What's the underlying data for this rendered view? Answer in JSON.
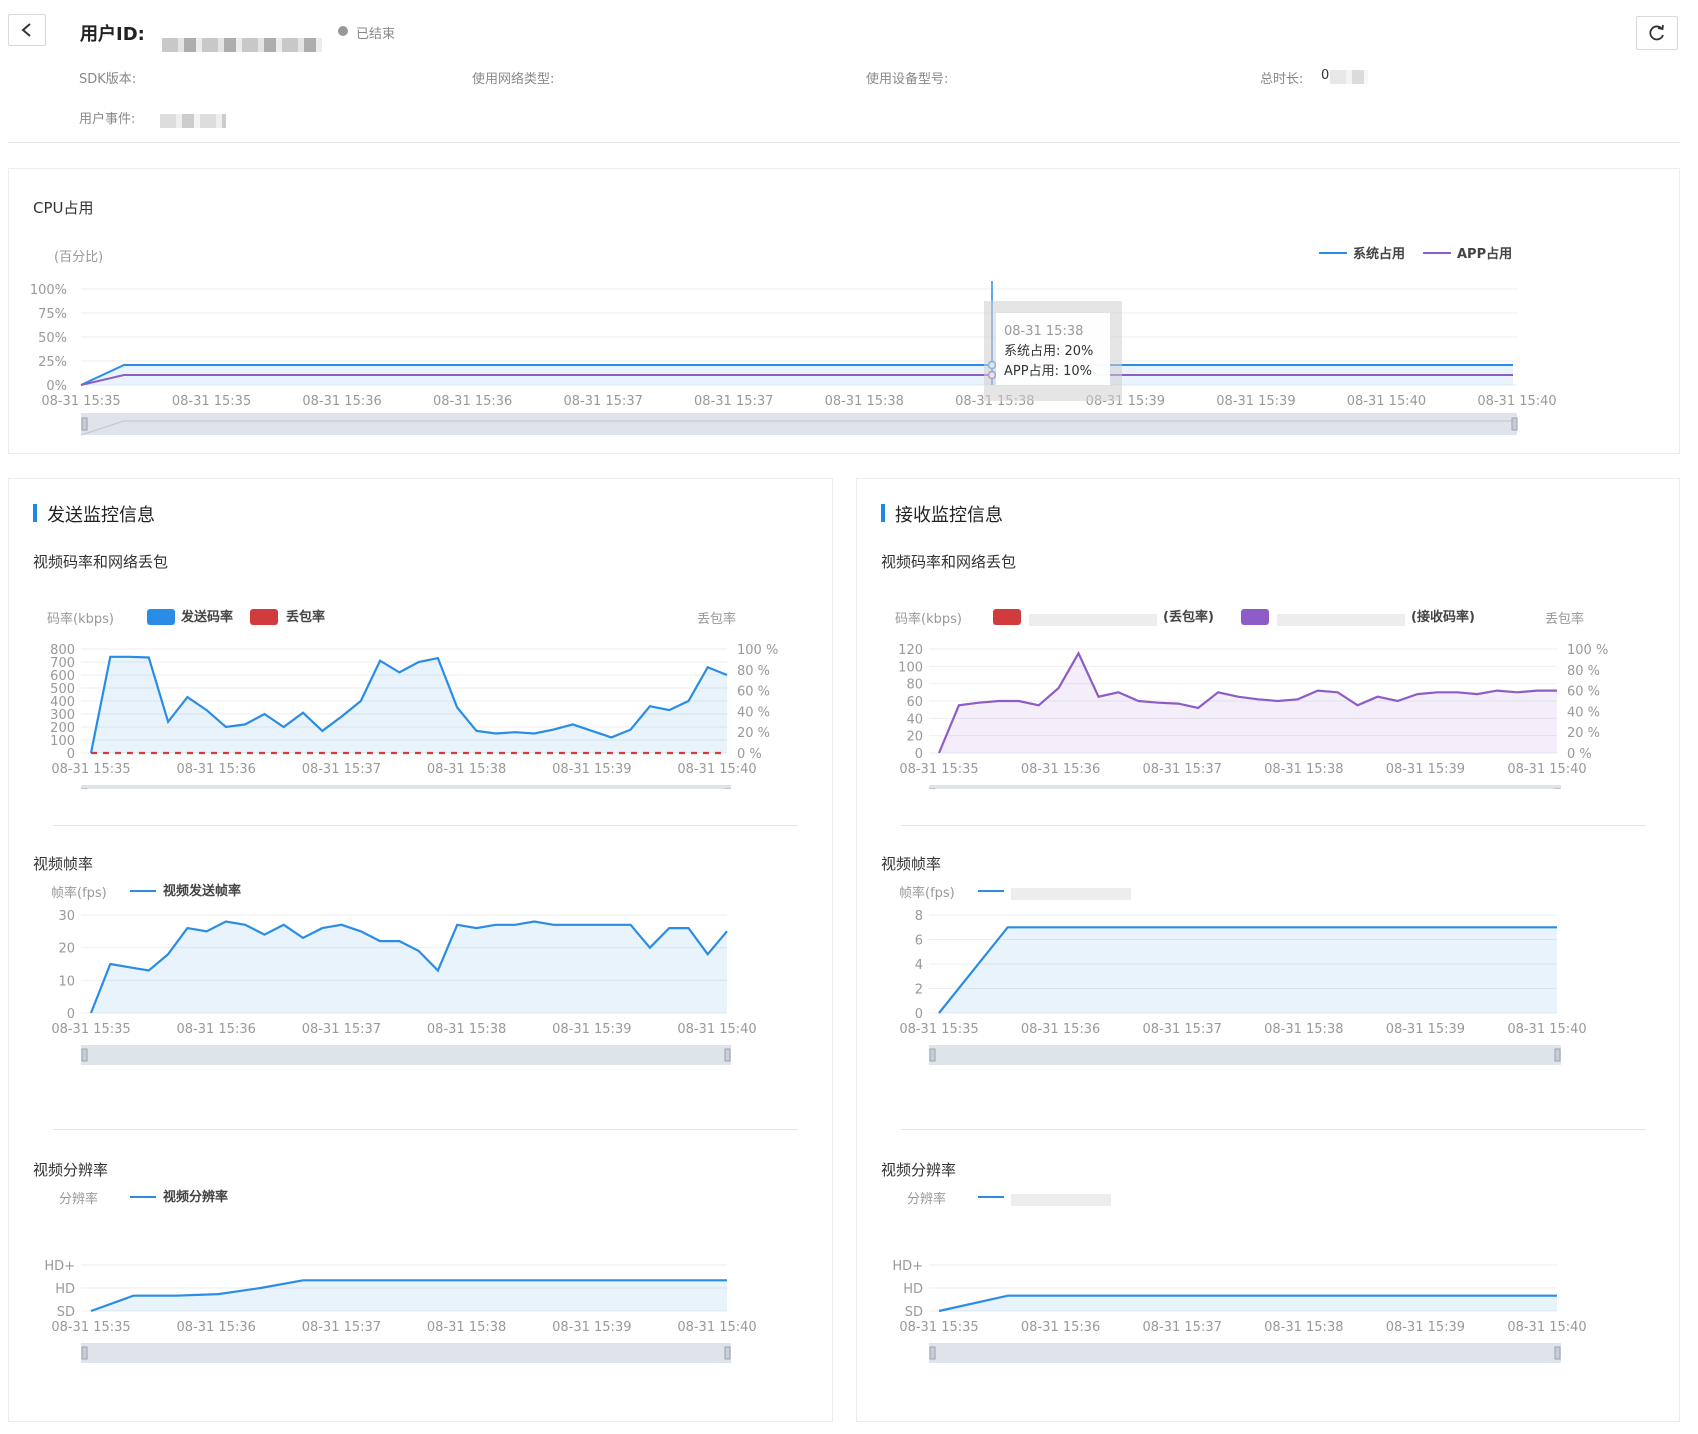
{
  "header": {
    "user_id_label": "用户ID:",
    "status_text": "已结束",
    "sdk_label": "SDK版本:",
    "network_label": "使用网络类型:",
    "device_label": "使用设备型号:",
    "duration_label": "总时长:",
    "duration_value": "0",
    "events_label": "用户事件:",
    "back_icon": "chevron-left-icon",
    "refresh_icon": "refresh-icon"
  },
  "colors": {
    "blue": "#2b8ce6",
    "purple": "#8d5cc7",
    "red": "#d13b3b",
    "grid": "#eeeeee",
    "axis": "#999999"
  },
  "time_ticks_cpu": [
    "08-31 15:35",
    "08-31 15:35",
    "08-31 15:36",
    "08-31 15:36",
    "08-31 15:37",
    "08-31 15:37",
    "08-31 15:38",
    "08-31 15:38",
    "08-31 15:39",
    "08-31 15:39",
    "08-31 15:40",
    "08-31 15:40"
  ],
  "time_ticks": [
    "08-31 15:35",
    "08-31 15:36",
    "08-31 15:37",
    "08-31 15:38",
    "08-31 15:39",
    "08-31 15:40"
  ],
  "cpu": {
    "title": "CPU占用",
    "y_unit": "(百分比)",
    "legend_sys": "系统占用",
    "legend_app": "APP占用",
    "y_ticks": [
      "100%",
      "75%",
      "50%",
      "25%",
      "0%"
    ],
    "tooltip": {
      "time": "08-31 15:38",
      "sys": "系统占用: 20%",
      "app": "APP占用: 10%"
    }
  },
  "send": {
    "section_title": "发送监控信息",
    "bitrate_title": "视频码率和网络丢包",
    "bitrate_unit": "码率(kbps)",
    "loss_unit": "丢包率",
    "legend_send": "发送码率",
    "legend_loss": "丢包率",
    "fps_title": "视频帧率",
    "fps_unit": "帧率(fps)",
    "fps_legend": "视频发送帧率",
    "res_title": "视频分辨率",
    "res_unit": "分辨率",
    "res_legend": "视频分辨率"
  },
  "recv": {
    "section_title": "接收监控信息",
    "bitrate_title": "视频码率和网络丢包",
    "bitrate_unit": "码率(kbps)",
    "loss_unit": "丢包率",
    "legend_loss": "(丢包率)",
    "legend_recv": "(接收码率)",
    "fps_title": "视频帧率",
    "fps_unit": "帧率(fps)",
    "res_title": "视频分辨率",
    "res_unit": "分辨率"
  },
  "loss_ticks": [
    "100 %",
    "80 %",
    "60 %",
    "40 %",
    "20 %",
    "0 %"
  ],
  "send_bitrate_ticks": [
    "800",
    "700",
    "600",
    "500",
    "400",
    "300",
    "200",
    "100",
    "0"
  ],
  "recv_bitrate_ticks": [
    "120",
    "100",
    "80",
    "60",
    "40",
    "20",
    "0"
  ],
  "send_fps_ticks": [
    "30",
    "20",
    "10",
    "0"
  ],
  "recv_fps_ticks": [
    "8",
    "6",
    "4",
    "2",
    "0"
  ],
  "res_ticks": [
    "HD+",
    "HD",
    "SD"
  ],
  "chart_data": [
    {
      "type": "line",
      "title": "CPU占用",
      "ylabel": "(百分比)",
      "ylim": [
        0,
        100
      ],
      "x": [
        "08-31 15:35",
        "08-31 15:40"
      ],
      "series": [
        {
          "name": "系统占用",
          "values": [
            0,
            20,
            20,
            20,
            20,
            20,
            20,
            20,
            20,
            20,
            20,
            20,
            20
          ]
        },
        {
          "name": "APP占用",
          "values": [
            0,
            10,
            10,
            10,
            10,
            10,
            10,
            10,
            10,
            10,
            10,
            10,
            10
          ]
        }
      ]
    },
    {
      "type": "area",
      "title": "视频码率和网络丢包",
      "ylabel": "码率(kbps)",
      "ylim": [
        0,
        800
      ],
      "series": [
        {
          "name": "发送码率",
          "values": [
            0,
            740,
            740,
            735,
            240,
            430,
            330,
            200,
            220,
            300,
            200,
            310,
            170,
            280,
            400,
            710,
            620,
            700,
            730,
            350,
            170,
            150,
            160,
            150,
            180,
            220,
            170,
            120,
            180,
            360,
            330,
            400,
            660,
            600
          ]
        },
        {
          "name": "丢包率",
          "values": [
            0,
            0,
            0,
            0,
            0,
            0,
            0,
            0,
            0,
            0,
            0,
            0,
            0,
            0,
            0,
            0,
            0,
            0,
            0,
            0,
            0,
            0,
            0,
            0,
            0,
            0,
            0,
            0,
            0,
            0,
            0,
            0,
            0,
            0
          ]
        }
      ]
    },
    {
      "type": "area",
      "title": "视频帧率",
      "ylabel": "帧率(fps)",
      "ylim": [
        0,
        30
      ],
      "series": [
        {
          "name": "视频发送帧率",
          "values": [
            0,
            15,
            14,
            13,
            18,
            26,
            25,
            28,
            27,
            24,
            27,
            23,
            26,
            27,
            25,
            22,
            22,
            19,
            13,
            27,
            26,
            27,
            27,
            28,
            27,
            27,
            27,
            27,
            27,
            20,
            26,
            26,
            18,
            25
          ]
        }
      ]
    },
    {
      "type": "area",
      "title": "视频分辨率",
      "ylabel": "分辨率",
      "series": [
        {
          "name": "视频分辨率",
          "values": [
            0,
            1,
            1,
            1.1,
            1.5,
            2,
            2,
            2,
            2,
            2,
            2,
            2,
            2,
            2,
            2,
            2
          ]
        }
      ]
    },
    {
      "type": "area",
      "title": "视频码率和网络丢包",
      "ylabel": "码率(kbps)",
      "ylim": [
        0,
        120
      ],
      "series": [
        {
          "name": "(接收码率)",
          "values": [
            0,
            55,
            58,
            60,
            60,
            55,
            75,
            115,
            65,
            70,
            60,
            58,
            57,
            52,
            70,
            65,
            62,
            60,
            62,
            72,
            70,
            55,
            65,
            60,
            68,
            70,
            70,
            68,
            72,
            70,
            72,
            72
          ]
        },
        {
          "name": "(丢包率)",
          "values": []
        }
      ]
    },
    {
      "type": "area",
      "title": "视频帧率",
      "ylabel": "帧率(fps)",
      "ylim": [
        0,
        8
      ],
      "series": [
        {
          "values": [
            0,
            7,
            7,
            7,
            7,
            7,
            7,
            7,
            7,
            7
          ]
        }
      ]
    },
    {
      "type": "area",
      "title": "视频分辨率",
      "ylabel": "分辨率",
      "series": [
        {
          "values": [
            0,
            1,
            1,
            1,
            1,
            1,
            1,
            1,
            1,
            1
          ]
        }
      ]
    }
  ]
}
